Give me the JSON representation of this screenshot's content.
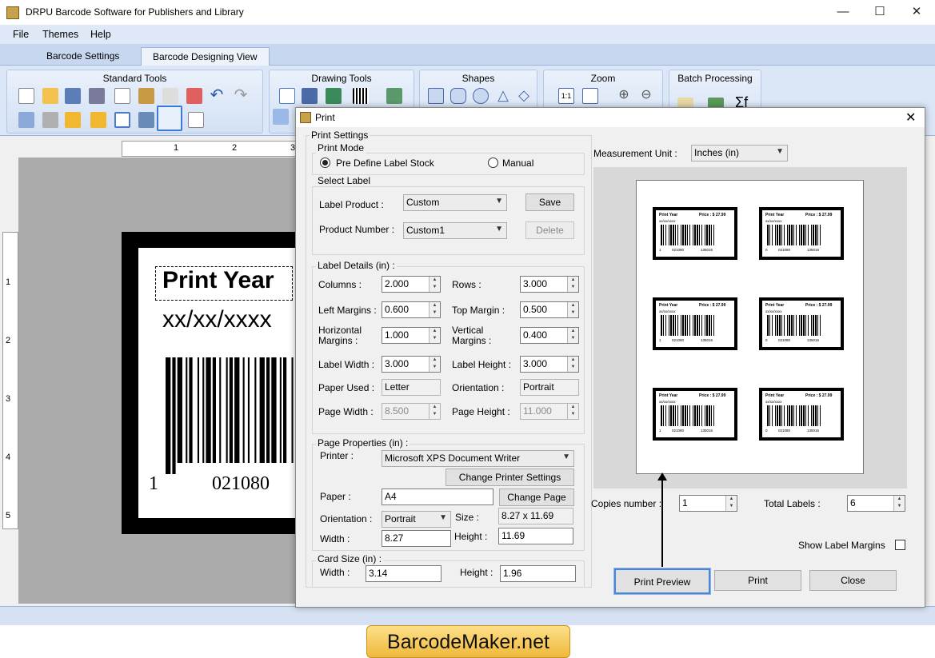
{
  "app": {
    "title": "DRPU Barcode Software for Publishers and Library"
  },
  "window_controls": {
    "minimize": "—",
    "maximize": "☐",
    "close": "✕"
  },
  "menu": [
    "File",
    "Themes",
    "Help"
  ],
  "tabs": [
    {
      "label": "Barcode Settings",
      "active": false
    },
    {
      "label": "Barcode Designing View",
      "active": true
    }
  ],
  "ribbon": {
    "groups": [
      {
        "title": "Standard Tools"
      },
      {
        "title": "Drawing Tools"
      },
      {
        "title": "Shapes"
      },
      {
        "title": "Zoom"
      },
      {
        "title": "Batch Processing"
      }
    ],
    "zoom_label": "1:1",
    "batch_formula_label": "Σf"
  },
  "ruler": {
    "h_ticks": [
      "1",
      "2",
      "3"
    ],
    "v_ticks": [
      "1",
      "2",
      "3",
      "4",
      "5"
    ]
  },
  "label_canvas": {
    "title": "Print Year",
    "date": "xx/xx/xxxx",
    "number_left": "1",
    "number_right": "021080"
  },
  "dialog": {
    "title": "Print",
    "close_glyph": "✕",
    "print_settings_title": "Print Settings",
    "print_mode": {
      "title": "Print Mode",
      "options": [
        {
          "label": "Pre Define Label Stock",
          "selected": true
        },
        {
          "label": "Manual",
          "selected": false
        }
      ]
    },
    "select_label": {
      "title": "Select Label",
      "label_product_label": "Label Product :",
      "label_product_value": "Custom",
      "product_number_label": "Product Number :",
      "product_number_value": "Custom1",
      "save": "Save",
      "delete": "Delete"
    },
    "label_details": {
      "title": "Label Details (in) :",
      "columns_label": "Columns :",
      "columns": "2.000",
      "rows_label": "Rows :",
      "rows": "3.000",
      "left_margins_label": "Left Margins :",
      "left_margins": "0.600",
      "top_margin_label": "Top Margin :",
      "top_margin": "0.500",
      "horizontal_margins_label": "Horizontal Margins :",
      "horizontal_margins": "1.000",
      "vertical_margins_label": "Vertical Margins :",
      "vertical_margins": "0.400",
      "label_width_label": "Label Width :",
      "label_width": "3.000",
      "label_height_label": "Label Height :",
      "label_height": "3.000",
      "paper_used_label": "Paper Used :",
      "paper_used": "Letter",
      "orientation_label": "Orientation :",
      "orientation": "Portrait",
      "page_width_label": "Page Width :",
      "page_width": "8.500",
      "page_height_label": "Page Height :",
      "page_height": "11.000"
    },
    "page_properties": {
      "title": "Page Properties (in) :",
      "printer_label": "Printer :",
      "printer": "Microsoft XPS Document Writer",
      "change_printer_settings": "Change Printer Settings",
      "paper_label": "Paper :",
      "paper": "A4",
      "change_page": "Change Page",
      "orientation_label": "Orientation :",
      "orientation": "Portrait",
      "size_label": "Size :",
      "size": "8.27 x 11.69",
      "width_label": "Width :",
      "width": "8.27",
      "height_label": "Height :",
      "height": "11.69"
    },
    "card_size": {
      "title": "Card Size (in) :",
      "width_label": "Width :",
      "width": "3.14",
      "height_label": "Height :",
      "height": "1.96"
    },
    "measurement_unit_label": "Measurement Unit :",
    "measurement_unit": "Inches (in)",
    "preview_labels": [
      {
        "title": "Print Year",
        "price": "Price : $ 27.99",
        "date": "xx/xx/xxxx",
        "n1": "1",
        "n2": "021080",
        "n3": "135016"
      },
      {
        "title": "Print Year",
        "price": "Price : $ 27.99",
        "date": "xx/xx/xxxx",
        "n1": "0",
        "n2": "021080",
        "n3": "135016"
      },
      {
        "title": "Print Year",
        "price": "Price : $ 27.99",
        "date": "xx/xx/xxxx",
        "n1": "1",
        "n2": "021080",
        "n3": "135016"
      },
      {
        "title": "Print Year",
        "price": "Price : $ 27.99",
        "date": "xx/xx/xxxx",
        "n1": "0",
        "n2": "021080",
        "n3": "135016"
      },
      {
        "title": "Print Year",
        "price": "Price : $ 27.99",
        "date": "xx/xx/xxxx",
        "n1": "1",
        "n2": "021080",
        "n3": "135016"
      },
      {
        "title": "Print Year",
        "price": "Price : $ 27.99",
        "date": "xx/xx/xxxx",
        "n1": "0",
        "n2": "021080",
        "n3": "135016"
      }
    ],
    "copies_label": "Copies number :",
    "copies": "1",
    "total_labels_label": "Total Labels :",
    "total_labels": "6",
    "show_margins_label": "Show Label Margins",
    "show_margins_checked": false,
    "print_preview": "Print Preview",
    "print": "Print",
    "close": "Close"
  },
  "branding": {
    "text": "BarcodeMaker.net"
  },
  "colors": {
    "ribbon_bg": "#dbe6f6",
    "accent_border": "#3b7ad9",
    "brand_bg": "#f0b93a"
  }
}
